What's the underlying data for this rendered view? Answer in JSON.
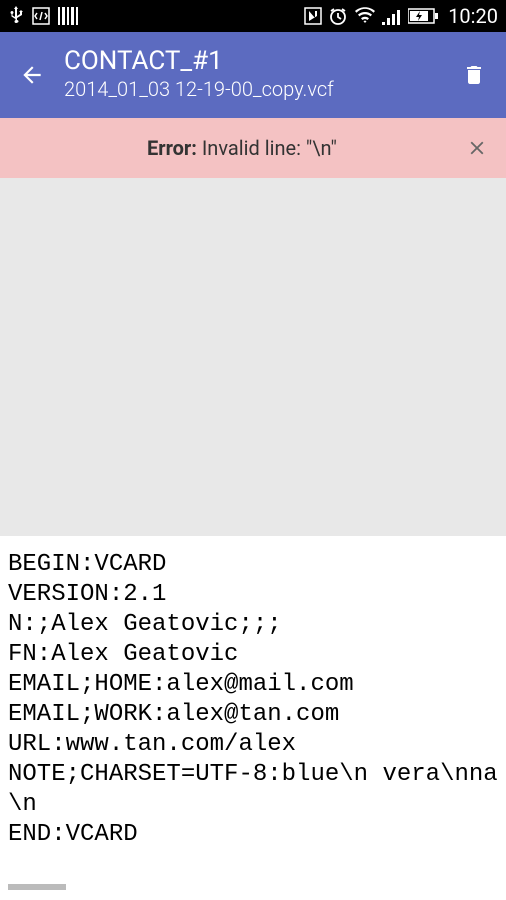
{
  "statusBar": {
    "time": "10:20"
  },
  "header": {
    "title": "CONTACT_#1",
    "subtitle": "2014_01_03 12-19-00_copy.vcf"
  },
  "error": {
    "label": "Error:",
    "message": " Invalid line: \"\\n\""
  },
  "vcard": {
    "content": "BEGIN:VCARD\nVERSION:2.1\nN:;Alex Geatovic;;;\nFN:Alex Geatovic\nEMAIL;HOME:alex@mail.com\nEMAIL;WORK:alex@tan.com\nURL:www.tan.com/alex\nNOTE;CHARSET=UTF-8:blue\\n vera\\nna\n\\n\nEND:VCARD"
  }
}
